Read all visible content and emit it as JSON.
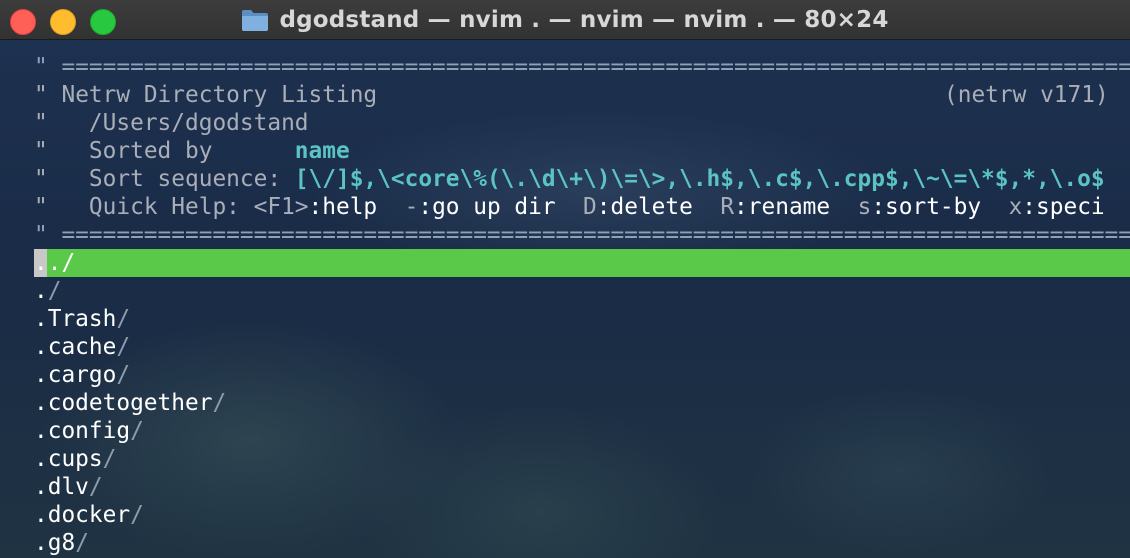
{
  "window": {
    "title": "dgodstand — nvim . — nvim — nvim . — 80×24",
    "folder_icon": "folder-icon",
    "traffic_lights": {
      "close": "#fe5f57",
      "minimize": "#febc2e",
      "zoom": "#28c840"
    }
  },
  "netrw": {
    "comment_mark": "\"",
    "separator": "\" =================================================================================",
    "header_title": "Netrw Directory Listing",
    "version": "(netrw v171)",
    "path": "/Users/dgodstand",
    "sorted_by_label": "Sorted by      ",
    "sorted_by_value": "name",
    "sort_sequence_label": "Sort sequence: ",
    "sort_sequence_value": "[\\/]$,\\<core\\%(\\.\\d\\+\\)\\=\\>,\\.h$,\\.c$,\\.cpp$,\\~\\=\\*$,*,\\.o$",
    "quick_help": {
      "label": "Quick Help: ",
      "items": [
        {
          "key": "<F1>",
          "desc": ":help  "
        },
        {
          "key": "-",
          "desc": ":go up dir  "
        },
        {
          "key": "D",
          "desc": ":delete  "
        },
        {
          "key": "R",
          "desc": ":rename  "
        },
        {
          "key": "s",
          "desc": ":sort-by  "
        },
        {
          "key": "x",
          "desc": ":speci"
        }
      ]
    }
  },
  "listing": {
    "current_entry": "../",
    "entries": [
      {
        "name": ".",
        "suffix": "/"
      },
      {
        "name": ".Trash",
        "suffix": "/"
      },
      {
        "name": ".cache",
        "suffix": "/"
      },
      {
        "name": ".cargo",
        "suffix": "/"
      },
      {
        "name": ".codetogether",
        "suffix": "/"
      },
      {
        "name": ".config",
        "suffix": "/"
      },
      {
        "name": ".cups",
        "suffix": "/"
      },
      {
        "name": ".dlv",
        "suffix": "/"
      },
      {
        "name": ".docker",
        "suffix": "/"
      },
      {
        "name": ".g8",
        "suffix": "/"
      }
    ]
  },
  "colors": {
    "current_line_bg": "#5ac94a",
    "highlight": "#5cc3c3",
    "comment": "#a9aeb8"
  }
}
